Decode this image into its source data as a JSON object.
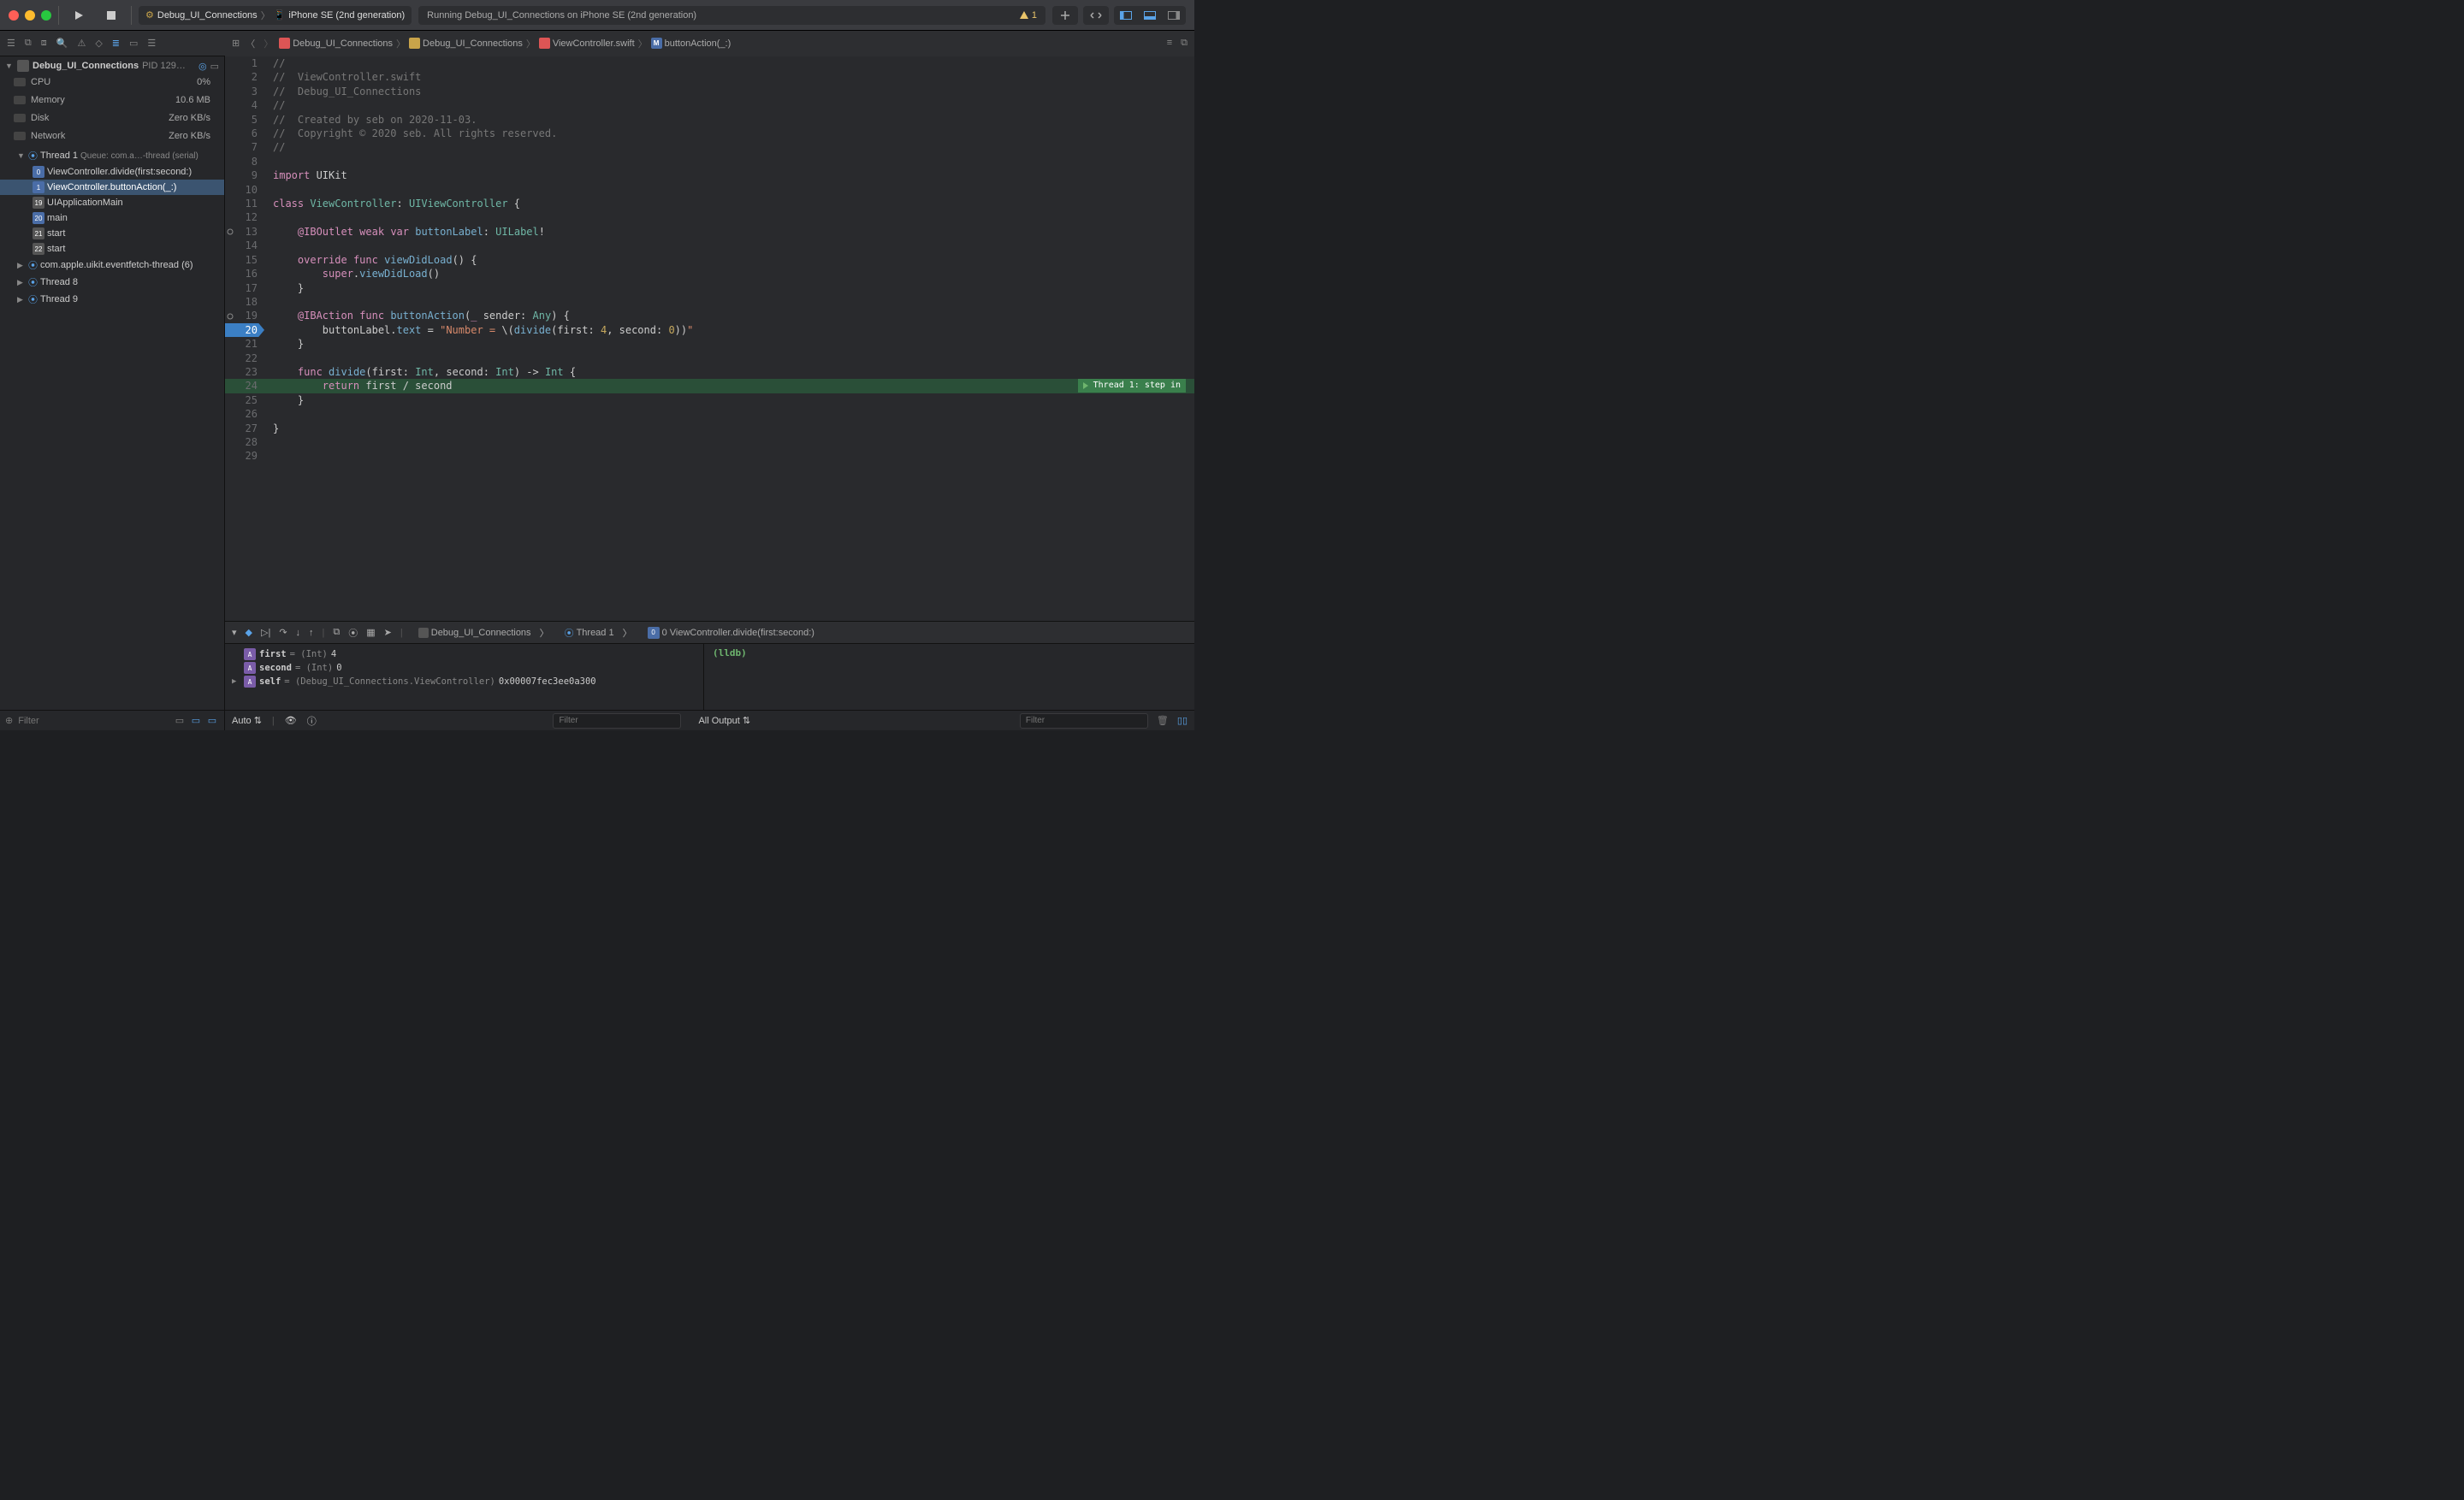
{
  "titlebar": {
    "scheme_name": "Debug_UI_Connections",
    "destination": "iPhone SE (2nd generation)",
    "status": "Running Debug_UI_Connections on iPhone SE (2nd generation)",
    "warning_count": "1"
  },
  "navigator": {
    "target": "Debug_UI_Connections",
    "pid": "PID 129…",
    "gauges": [
      {
        "name": "CPU",
        "value": "0%",
        "fill": 2
      },
      {
        "name": "Memory",
        "value": "10.6 MB",
        "fill": 12
      },
      {
        "name": "Disk",
        "value": "Zero KB/s",
        "fill": 0
      },
      {
        "name": "Network",
        "value": "Zero KB/s",
        "fill": 0
      }
    ],
    "thread1_label": "Thread 1",
    "thread1_queue": "Queue: com.a…-thread (serial)",
    "frames": [
      {
        "n": "0",
        "label": "ViewController.divide(first:second:)",
        "user": true
      },
      {
        "n": "1",
        "label": "ViewController.buttonAction(_:)",
        "user": true,
        "sel": true
      },
      {
        "n": "19",
        "label": "UIApplicationMain",
        "user": false
      },
      {
        "n": "20",
        "label": "main",
        "user": true
      },
      {
        "n": "21",
        "label": "start",
        "user": false
      },
      {
        "n": "22",
        "label": "start",
        "user": false
      }
    ],
    "other_threads": [
      {
        "label": "com.apple.uikit.eventfetch-thread (6)"
      },
      {
        "label": "Thread 8"
      },
      {
        "label": "Thread 9"
      }
    ],
    "filter_placeholder": "Filter"
  },
  "jumpbar": {
    "crumbs": [
      "Debug_UI_Connections",
      "Debug_UI_Connections",
      "ViewController.swift",
      "buttonAction(_:)"
    ]
  },
  "code": {
    "lines": [
      {
        "n": 1,
        "html": "<span class='comment'>//</span>"
      },
      {
        "n": 2,
        "html": "<span class='comment'>//  ViewController.swift</span>"
      },
      {
        "n": 3,
        "html": "<span class='comment'>//  Debug_UI_Connections</span>"
      },
      {
        "n": 4,
        "html": "<span class='comment'>//</span>"
      },
      {
        "n": 5,
        "html": "<span class='comment'>//  Created by seb on 2020-11-03.</span>"
      },
      {
        "n": 6,
        "html": "<span class='comment'>//  Copyright © 2020 seb. All rights reserved.</span>"
      },
      {
        "n": 7,
        "html": "<span class='comment'>//</span>"
      },
      {
        "n": 8,
        "html": ""
      },
      {
        "n": 9,
        "html": "<span class='kw'>import</span> UIKit"
      },
      {
        "n": 10,
        "html": ""
      },
      {
        "n": 11,
        "html": "<span class='kw'>class</span> <span class='type'>ViewController</span>: <span class='type'>UIViewController</span> {"
      },
      {
        "n": 12,
        "html": ""
      },
      {
        "n": 13,
        "html": "    <span class='kw'>@IBOutlet</span> <span class='kw'>weak</span> <span class='kw'>var</span> <span class='prop'>buttonLabel</span>: <span class='type'>UILabel</span>!",
        "dot": true
      },
      {
        "n": 14,
        "html": ""
      },
      {
        "n": 15,
        "html": "    <span class='kw'>override</span> <span class='kw'>func</span> <span class='fn'>viewDidLoad</span>() {"
      },
      {
        "n": 16,
        "html": "        <span class='kw'>super</span>.<span class='fn'>viewDidLoad</span>()"
      },
      {
        "n": 17,
        "html": "    }"
      },
      {
        "n": 18,
        "html": ""
      },
      {
        "n": 19,
        "html": "    <span class='kw'>@IBAction</span> <span class='kw'>func</span> <span class='fn'>buttonAction</span>(<span class='kw'>_</span> sender: <span class='type'>Any</span>) {",
        "dot": true
      },
      {
        "n": 20,
        "html": "        buttonLabel.<span class='prop'>text</span> = <span class='str'>\"Number = </span>\\(<span class='fn'>divide</span>(first: <span class='num'>4</span>, second: <span class='num'>0</span>))<span class='str'>\"</span>",
        "bp": true
      },
      {
        "n": 21,
        "html": "    }"
      },
      {
        "n": 22,
        "html": ""
      },
      {
        "n": 23,
        "html": "    <span class='kw'>func</span> <span class='fn'>divide</span>(first: <span class='type'>Int</span>, second: <span class='type'>Int</span>) -&gt; <span class='type'>Int</span> {"
      },
      {
        "n": 24,
        "html": "        <span class='kw'>return</span> first / second",
        "hl": true,
        "exec": "Thread 1: step in"
      },
      {
        "n": 25,
        "html": "    }"
      },
      {
        "n": 26,
        "html": ""
      },
      {
        "n": 27,
        "html": "}"
      },
      {
        "n": 28,
        "html": ""
      },
      {
        "n": 29,
        "html": ""
      }
    ]
  },
  "debugbar": {
    "crumb_target": "Debug_UI_Connections",
    "crumb_thread": "Thread 1",
    "crumb_frame": "0 ViewController.divide(first:second:)"
  },
  "variables": [
    {
      "name": "first",
      "type": "(Int)",
      "value": "4"
    },
    {
      "name": "second",
      "type": "(Int)",
      "value": "0"
    },
    {
      "name": "self",
      "type": "(Debug_UI_Connections.ViewController)",
      "value": "0x00007fec3ee0a300",
      "disc": true
    }
  ],
  "footer": {
    "auto": "Auto",
    "all_output": "All Output",
    "filter_placeholder": "Filter"
  },
  "console": {
    "prompt": "(lldb)"
  }
}
